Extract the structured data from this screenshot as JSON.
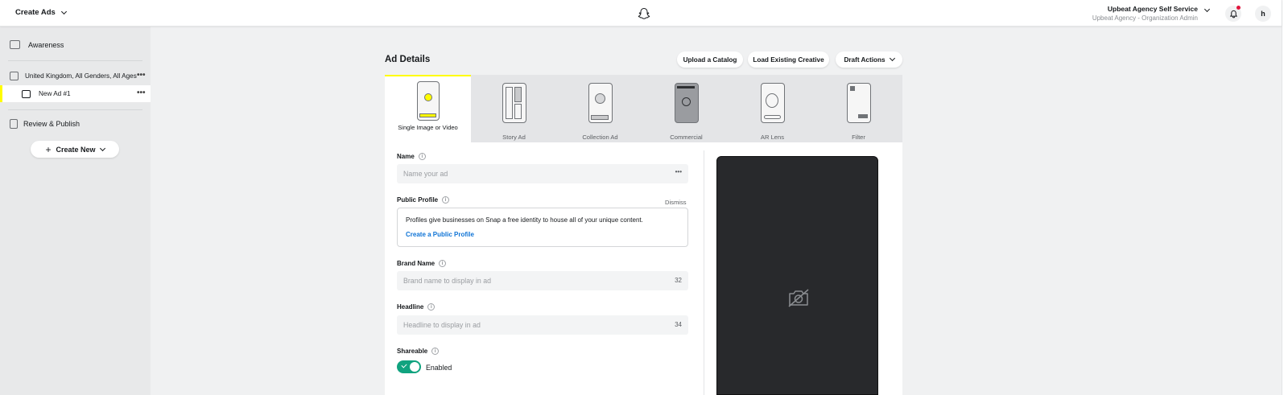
{
  "header": {
    "app_title": "Create Ads",
    "org_name": "Upbeat Agency Self Service",
    "org_role": "Upbeat Agency - Organization Admin",
    "avatar_letter": "h"
  },
  "sidebar": {
    "awareness": "Awareness",
    "adset": "United Kingdom, All Genders, All Ages",
    "new_ad": "New Ad #1",
    "review": "Review & Publish",
    "create_new": "Create New",
    "more": "•••"
  },
  "ad_details": {
    "title": "Ad Details",
    "upload_catalog": "Upload a Catalog",
    "load_creative": "Load Existing Creative",
    "draft_actions": "Draft Actions"
  },
  "ad_types": [
    {
      "label": "Single Image or Video"
    },
    {
      "label": "Story Ad"
    },
    {
      "label": "Collection Ad"
    },
    {
      "label": "Commercial"
    },
    {
      "label": "AR Lens"
    },
    {
      "label": "Filter"
    }
  ],
  "form": {
    "name_label": "Name",
    "name_placeholder": "Name your ad",
    "public_profile_label": "Public Profile",
    "dismiss": "Dismiss",
    "pp_description": "Profiles give businesses on Snap a free identity to house all of your unique content.",
    "pp_link": "Create a Public Profile",
    "brand_label": "Brand Name",
    "brand_placeholder": "Brand name to display in ad",
    "brand_count": "32",
    "headline_label": "Headline",
    "headline_placeholder": "Headline to display in ad",
    "headline_count": "34",
    "shareable_label": "Shareable",
    "shareable_state": "Enabled",
    "info": "i",
    "more": "•••"
  },
  "colors": {
    "accent_yellow": "#fffc00",
    "toggle_green": "#10a37f",
    "link_blue": "#0f74d6",
    "notification_red": "#e1143c"
  }
}
